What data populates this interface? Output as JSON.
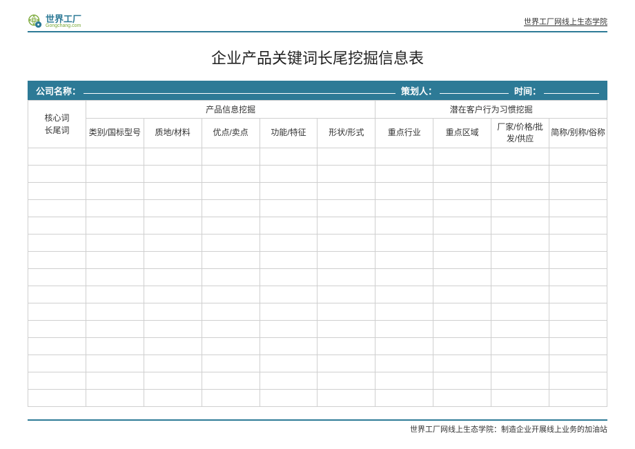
{
  "header": {
    "logo_main": "世界工厂",
    "logo_sub": "Gongchang.com",
    "right_text": "世界工厂网线上生态学院"
  },
  "title": "企业产品关键词长尾挖掘信息表",
  "info_bar": {
    "company_label": "公司名称：",
    "planner_label": "策划人：",
    "time_label": "时间："
  },
  "table": {
    "group_headers": {
      "row_header": "",
      "product_info": "产品信息挖掘",
      "customer_behavior": "潜在客户行为习惯挖掘"
    },
    "row_header_labels": {
      "core": "核心词",
      "long_tail": "长尾词"
    },
    "columns": [
      "类别/国标型号",
      "质地/材料",
      "优点/卖点",
      "功能/特征",
      "形状/形式",
      "重点行业",
      "重点区域",
      "厂家/价格/批发/供应",
      "简称/别称/俗称"
    ],
    "body_row_count": 15
  },
  "footer": "世界工厂网线上生态学院：制造企业开展线上业务的加油站"
}
